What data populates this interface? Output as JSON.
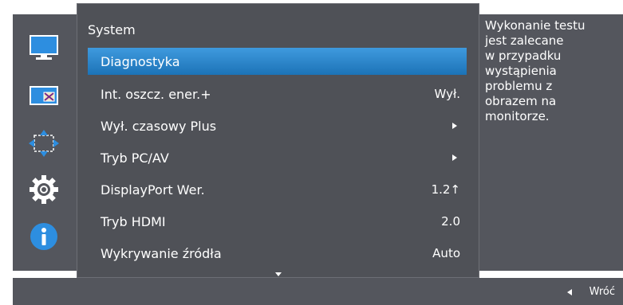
{
  "panel": {
    "title": "System"
  },
  "menu": [
    {
      "label": "Diagnostyka",
      "value": "",
      "arrow": false,
      "selected": true
    },
    {
      "label": "Int. oszcz. ener.+",
      "value": "Wył.",
      "arrow": false,
      "selected": false
    },
    {
      "label": "Wył. czasowy Plus",
      "value": "",
      "arrow": true,
      "selected": false
    },
    {
      "label": "Tryb PC/AV",
      "value": "",
      "arrow": true,
      "selected": false
    },
    {
      "label": "DisplayPort Wer.",
      "value": "1.2↑",
      "arrow": false,
      "selected": false
    },
    {
      "label": "Tryb HDMI",
      "value": "2.0",
      "arrow": false,
      "selected": false
    },
    {
      "label": "Wykrywanie źródła",
      "value": "Auto",
      "arrow": false,
      "selected": false
    }
  ],
  "help": {
    "lines": [
      "Wykonanie testu",
      "jest zalecane",
      "w przypadku",
      "wystąpienia",
      "problemu z",
      "obrazem na",
      "monitorze."
    ]
  },
  "footer": {
    "back_label": "Wróć"
  },
  "sidebar": {
    "icons": [
      "monitor-picture-icon",
      "picture-in-picture-icon",
      "resize-arrows-icon",
      "gear-icon",
      "info-icon"
    ]
  },
  "colors": {
    "accent": "#2a86cc",
    "panel": "#4f5157",
    "sidebar": "#54565d",
    "icon_blue": "#2d8ee0"
  }
}
